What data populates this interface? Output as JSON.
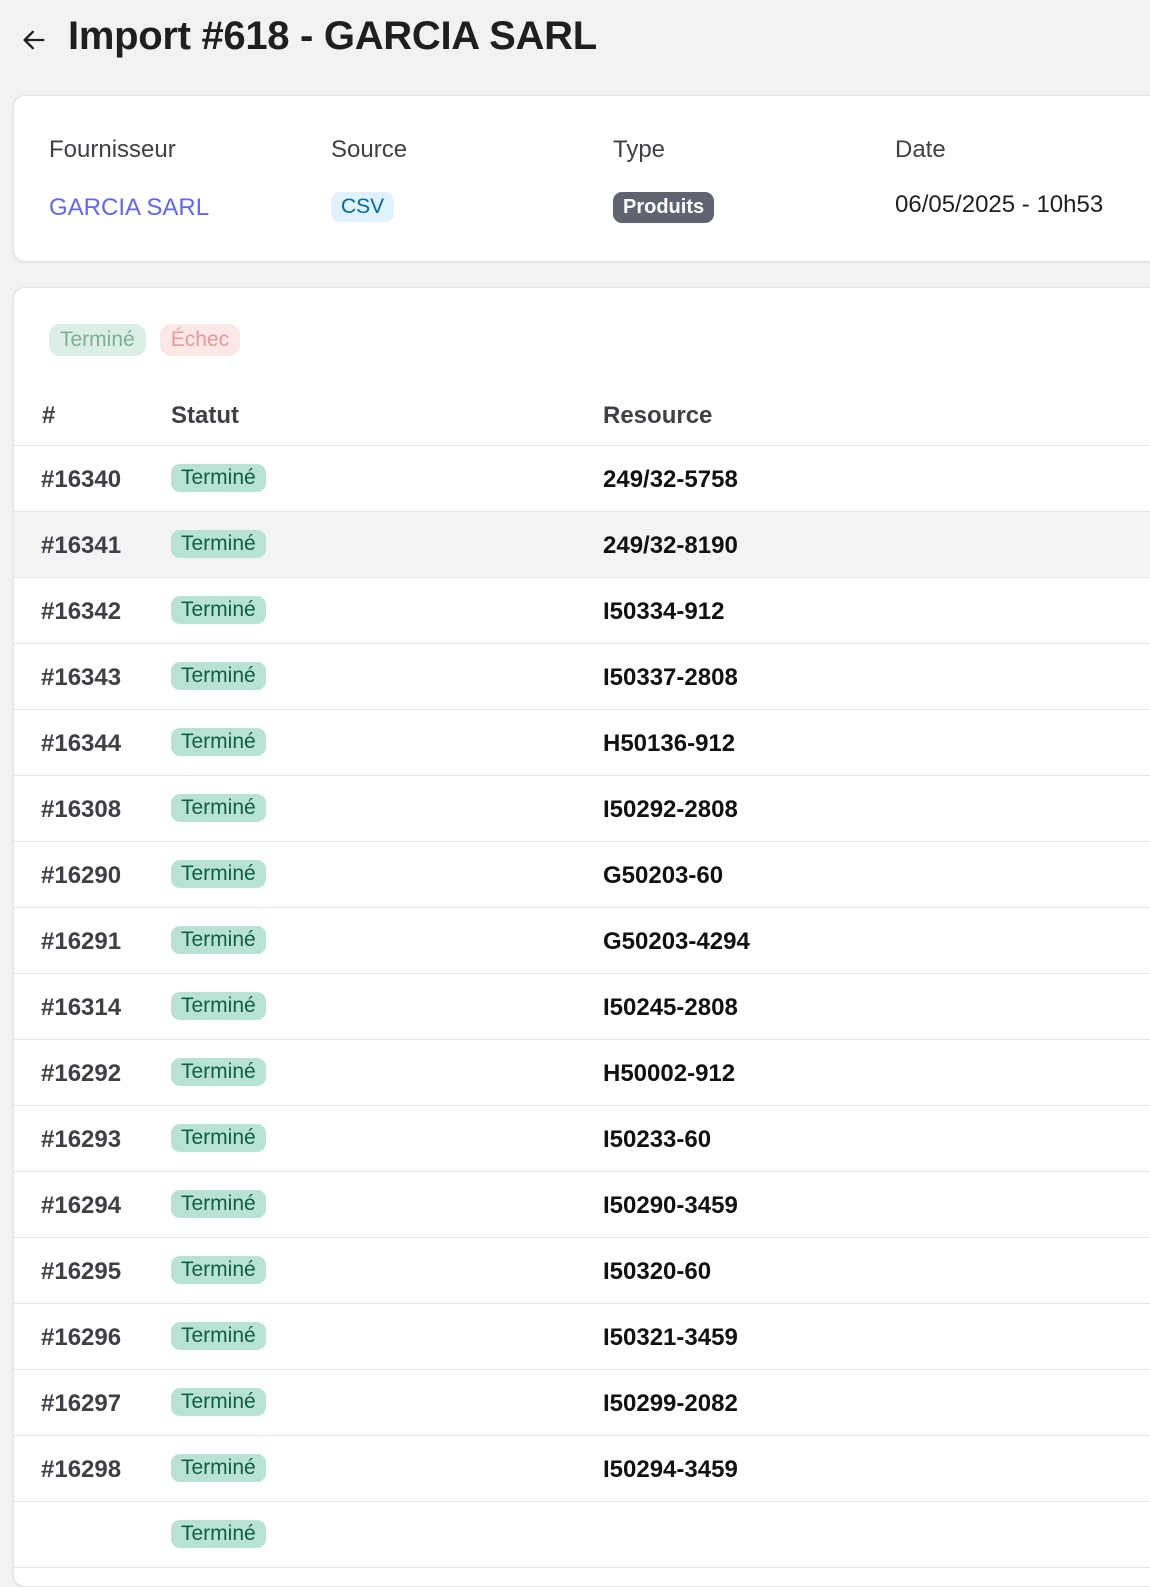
{
  "header": {
    "title": "Import #618 - GARCIA SARL",
    "back_icon": "arrow-left-icon"
  },
  "info": {
    "supplier_label": "Fournisseur",
    "supplier_value": "GARCIA SARL",
    "source_label": "Source",
    "source_value": "CSV",
    "type_label": "Type",
    "type_value": "Produits",
    "date_label": "Date",
    "date_value": "06/05/2025 - 10h53"
  },
  "filters": {
    "done": "Terminé",
    "failed": "Échec"
  },
  "table": {
    "columns": {
      "id": "#",
      "status": "Statut",
      "resource": "Resource"
    },
    "rows": [
      {
        "id": "#16340",
        "status": "Terminé",
        "resource": "249/32-5758"
      },
      {
        "id": "#16341",
        "status": "Terminé",
        "resource": "249/32-8190"
      },
      {
        "id": "#16342",
        "status": "Terminé",
        "resource": "I50334-912"
      },
      {
        "id": "#16343",
        "status": "Terminé",
        "resource": "I50337-2808"
      },
      {
        "id": "#16344",
        "status": "Terminé",
        "resource": "H50136-912"
      },
      {
        "id": "#16308",
        "status": "Terminé",
        "resource": "I50292-2808"
      },
      {
        "id": "#16290",
        "status": "Terminé",
        "resource": "G50203-60"
      },
      {
        "id": "#16291",
        "status": "Terminé",
        "resource": "G50203-4294"
      },
      {
        "id": "#16314",
        "status": "Terminé",
        "resource": "I50245-2808"
      },
      {
        "id": "#16292",
        "status": "Terminé",
        "resource": "H50002-912"
      },
      {
        "id": "#16293",
        "status": "Terminé",
        "resource": "I50233-60"
      },
      {
        "id": "#16294",
        "status": "Terminé",
        "resource": "I50290-3459"
      },
      {
        "id": "#16295",
        "status": "Terminé",
        "resource": "I50320-60"
      },
      {
        "id": "#16296",
        "status": "Terminé",
        "resource": "I50321-3459"
      },
      {
        "id": "#16297",
        "status": "Terminé",
        "resource": "I50299-2082"
      },
      {
        "id": "#16298",
        "status": "Terminé",
        "resource": "I50294-3459"
      },
      {
        "id": "",
        "status": "Terminé",
        "resource": ""
      }
    ]
  },
  "colors": {
    "accent": "#6366f1",
    "status_done_bg": "#b8e3d3",
    "status_done_text": "#0f5f44"
  }
}
